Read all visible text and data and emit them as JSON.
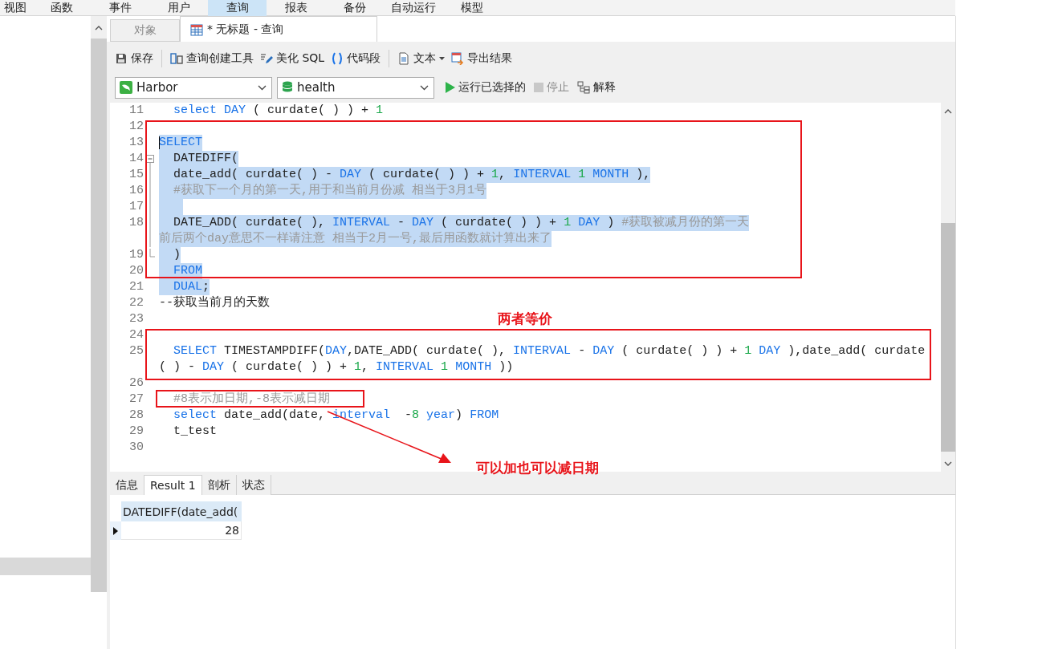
{
  "menu": [
    {
      "label": "视图",
      "selected": false
    },
    {
      "label": "函数",
      "selected": false
    },
    {
      "label": "事件",
      "selected": false
    },
    {
      "label": "用户",
      "selected": false
    },
    {
      "label": "查询",
      "selected": true
    },
    {
      "label": "报表",
      "selected": false
    },
    {
      "label": "备份",
      "selected": false
    },
    {
      "label": "自动运行",
      "selected": false
    },
    {
      "label": "模型",
      "selected": false
    }
  ],
  "tabs": [
    {
      "label": "对象",
      "selected": false
    },
    {
      "label": "* 无标题 - 查询",
      "selected": true
    }
  ],
  "toolbar": [
    {
      "label": "保存",
      "dropdown": false
    },
    {
      "label": "查询创建工具",
      "dropdown": false
    },
    {
      "label": "美化 SQL",
      "dropdown": false
    },
    {
      "label": "代码段",
      "dropdown": false
    },
    {
      "label": "文本",
      "dropdown": true
    },
    {
      "label": "导出结果",
      "dropdown": false
    }
  ],
  "connection": {
    "value": "Harbor"
  },
  "database": {
    "value": "health"
  },
  "actions": [
    {
      "label": "运行已选择的",
      "disabled": false
    },
    {
      "label": "停止",
      "disabled": true
    },
    {
      "label": "解释",
      "disabled": false
    }
  ],
  "code": [
    {
      "number": "11",
      "selected": false,
      "segments": [
        {
          "kind": "kw",
          "text": "  select "
        },
        {
          "kind": "kw",
          "text": "DAY"
        },
        {
          "kind": "text",
          "text": " ( curdate( ) ) + "
        },
        {
          "kind": "num",
          "text": "1"
        }
      ]
    },
    {
      "number": "12",
      "selected": false
    },
    {
      "number": "13",
      "selected": true,
      "cursor": true,
      "segments": [
        {
          "kind": "kw",
          "text": "SELECT"
        }
      ]
    },
    {
      "number": "14",
      "selected": true,
      "fold_open": true,
      "segments": [
        {
          "kind": "text",
          "text": "  DATEDIFF("
        }
      ]
    },
    {
      "number": "15",
      "selected": true,
      "in_fold": true,
      "segments": [
        {
          "kind": "text",
          "text": "  date_add( curdate( ) - "
        },
        {
          "kind": "kw",
          "text": "DAY"
        },
        {
          "kind": "text",
          "text": " ( curdate( ) ) + "
        },
        {
          "kind": "num",
          "text": "1"
        },
        {
          "kind": "text",
          "text": ", "
        },
        {
          "kind": "kw",
          "text": "INTERVAL "
        },
        {
          "kind": "num",
          "text": "1"
        },
        {
          "kind": "kw",
          "text": " MONTH"
        },
        {
          "kind": "text",
          "text": " ),"
        }
      ]
    },
    {
      "number": "16",
      "selected": true,
      "in_fold": true,
      "segments": [
        {
          "kind": "cmt",
          "text": "  #获取下一个月的第一天,用于和当前月份减 相当于3月1号"
        }
      ]
    },
    {
      "number": "17",
      "selected": true,
      "in_fold": true
    },
    {
      "number": "18",
      "selected": true,
      "in_fold": true,
      "segments": [
        {
          "kind": "text",
          "text": "  DATE_ADD( curdate( ), "
        },
        {
          "kind": "kw",
          "text": "INTERVAL"
        },
        {
          "kind": "text",
          "text": " - "
        },
        {
          "kind": "kw",
          "text": "DAY"
        },
        {
          "kind": "text",
          "text": " ( curdate( ) ) + "
        },
        {
          "kind": "num",
          "text": "1"
        },
        {
          "kind": "kw",
          "text": " DAY"
        },
        {
          "kind": "text",
          "text": " ) "
        },
        {
          "kind": "cmt",
          "text": "#获取被减月份的第一天"
        }
      ]
    },
    {
      "selected": true,
      "in_fold": true,
      "segments": [
        {
          "kind": "cmt",
          "text": "前后两个day意思不一样请注意 相当于2月一号,最后用函数就计算出来了"
        }
      ]
    },
    {
      "number": "19",
      "selected": true,
      "fold_end": true,
      "segments": [
        {
          "kind": "text",
          "text": "  )"
        }
      ]
    },
    {
      "number": "20",
      "selected": true,
      "segments": [
        {
          "kind": "kw",
          "text": "  FROM"
        }
      ]
    },
    {
      "number": "21",
      "selected": true,
      "segments": [
        {
          "kind": "kw",
          "text": "  DUAL"
        },
        {
          "kind": "text",
          "text": ";"
        }
      ]
    },
    {
      "number": "22",
      "selected": false,
      "segments": [
        {
          "kind": "text",
          "text": "--获取当前月的天数"
        }
      ]
    },
    {
      "number": "23",
      "selected": false
    },
    {
      "number": "24",
      "selected": false
    },
    {
      "number": "25",
      "selected": false,
      "segments": [
        {
          "kind": "kw",
          "text": "  SELECT"
        },
        {
          "kind": "text",
          "text": " TIMESTAMPDIFF("
        },
        {
          "kind": "kw",
          "text": "DAY"
        },
        {
          "kind": "text",
          "text": ",DATE_ADD( curdate( ), "
        },
        {
          "kind": "kw",
          "text": "INTERVAL"
        },
        {
          "kind": "text",
          "text": " - "
        },
        {
          "kind": "kw",
          "text": "DAY"
        },
        {
          "kind": "text",
          "text": " ( curdate( ) ) + "
        },
        {
          "kind": "num",
          "text": "1"
        },
        {
          "kind": "kw",
          "text": " DAY"
        },
        {
          "kind": "text",
          "text": " ),date_add( curdate"
        }
      ]
    },
    {
      "selected": false,
      "segments": [
        {
          "kind": "text",
          "text": "( ) - "
        },
        {
          "kind": "kw",
          "text": "DAY"
        },
        {
          "kind": "text",
          "text": " ( curdate( ) ) + "
        },
        {
          "kind": "num",
          "text": "1"
        },
        {
          "kind": "text",
          "text": ", "
        },
        {
          "kind": "kw",
          "text": "INTERVAL "
        },
        {
          "kind": "num",
          "text": "1"
        },
        {
          "kind": "kw",
          "text": " MONTH"
        },
        {
          "kind": "text",
          "text": " ))"
        }
      ]
    },
    {
      "number": "26",
      "selected": false
    },
    {
      "number": "27",
      "selected": false,
      "segments": [
        {
          "kind": "cmt",
          "text": "  #8表示加日期,-8表示减日期"
        }
      ]
    },
    {
      "number": "28",
      "selected": false,
      "segments": [
        {
          "kind": "kw",
          "text": "  select"
        },
        {
          "kind": "text",
          "text": " date_add(date, "
        },
        {
          "kind": "kw",
          "text": "interval"
        },
        {
          "kind": "text",
          "text": "  -"
        },
        {
          "kind": "num",
          "text": "8"
        },
        {
          "kind": "kw",
          "text": " year"
        },
        {
          "kind": "text",
          "text": ") "
        },
        {
          "kind": "kw",
          "text": "FROM"
        }
      ]
    },
    {
      "number": "29",
      "selected": false,
      "segments": [
        {
          "kind": "text",
          "text": "  t_test"
        }
      ]
    },
    {
      "number": "30",
      "selected": false
    }
  ],
  "annotations": [
    {
      "text": "两者等价"
    },
    {
      "text": "可以加也可以减日期"
    }
  ],
  "result_tabs": [
    {
      "label": "信息",
      "selected": false
    },
    {
      "label": "Result 1",
      "selected": true
    },
    {
      "label": "剖析",
      "selected": false
    },
    {
      "label": "状态",
      "selected": false
    }
  ],
  "result": {
    "columns": [
      "DATEDIFF(date_add("
    ],
    "rows": [
      {
        "current": true,
        "cells": [
          "28"
        ]
      }
    ]
  },
  "left_panel": {
    "items": [
      {
        "selected": true
      }
    ]
  }
}
